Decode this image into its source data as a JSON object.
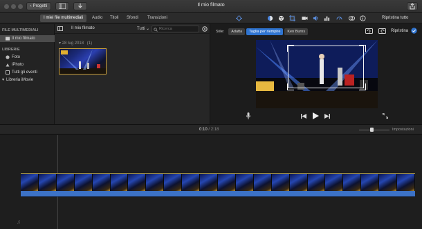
{
  "titlebar": {
    "back_label": "Progetti",
    "title": "Il mio filmato",
    "colors": {
      "bar": "#333333"
    }
  },
  "toolbar": {
    "tabs": [
      "I miei file multimediali",
      "Audio",
      "Titoli",
      "Sfondi",
      "Transizioni"
    ],
    "active_tab": "I miei file multimediali",
    "reset_all_label": "Ripristina tutto",
    "icons": [
      "magic-wand-icon",
      "color-balance-icon",
      "color-palette-icon",
      "crop-icon",
      "camera-icon",
      "speaker-icon",
      "chart-icon",
      "speedometer-icon",
      "filter-icon",
      "info-icon"
    ]
  },
  "sidebar": {
    "media_header": "FILE MULTIMEDIALI",
    "project_item": "Il mio filmato",
    "libraries_header": "LIBRERIE",
    "items": [
      "Foto",
      "iPhoto",
      "Tutti gli eventi"
    ],
    "imovie_library": "Libreria iMovie"
  },
  "browser": {
    "title": "Il mio filmato",
    "filter_label": "Tutti",
    "search_placeholder": "Ricerca",
    "date_group": "28 lug 2018",
    "date_count": "(1)"
  },
  "viewer": {
    "style_label": "Stile:",
    "style_options": [
      "Adatta",
      "Taglia per riempire",
      "Ken Burns"
    ],
    "selected_style": "Taglia per riempire",
    "reset_label": "Ripristina",
    "accent": "#2f74d0"
  },
  "timeline": {
    "current_time": "0:10",
    "separator": "/",
    "total_time": "2:18",
    "settings_label": "Impostazioni",
    "zoom_level": 0.4,
    "clip_color": "#3c72c6"
  }
}
